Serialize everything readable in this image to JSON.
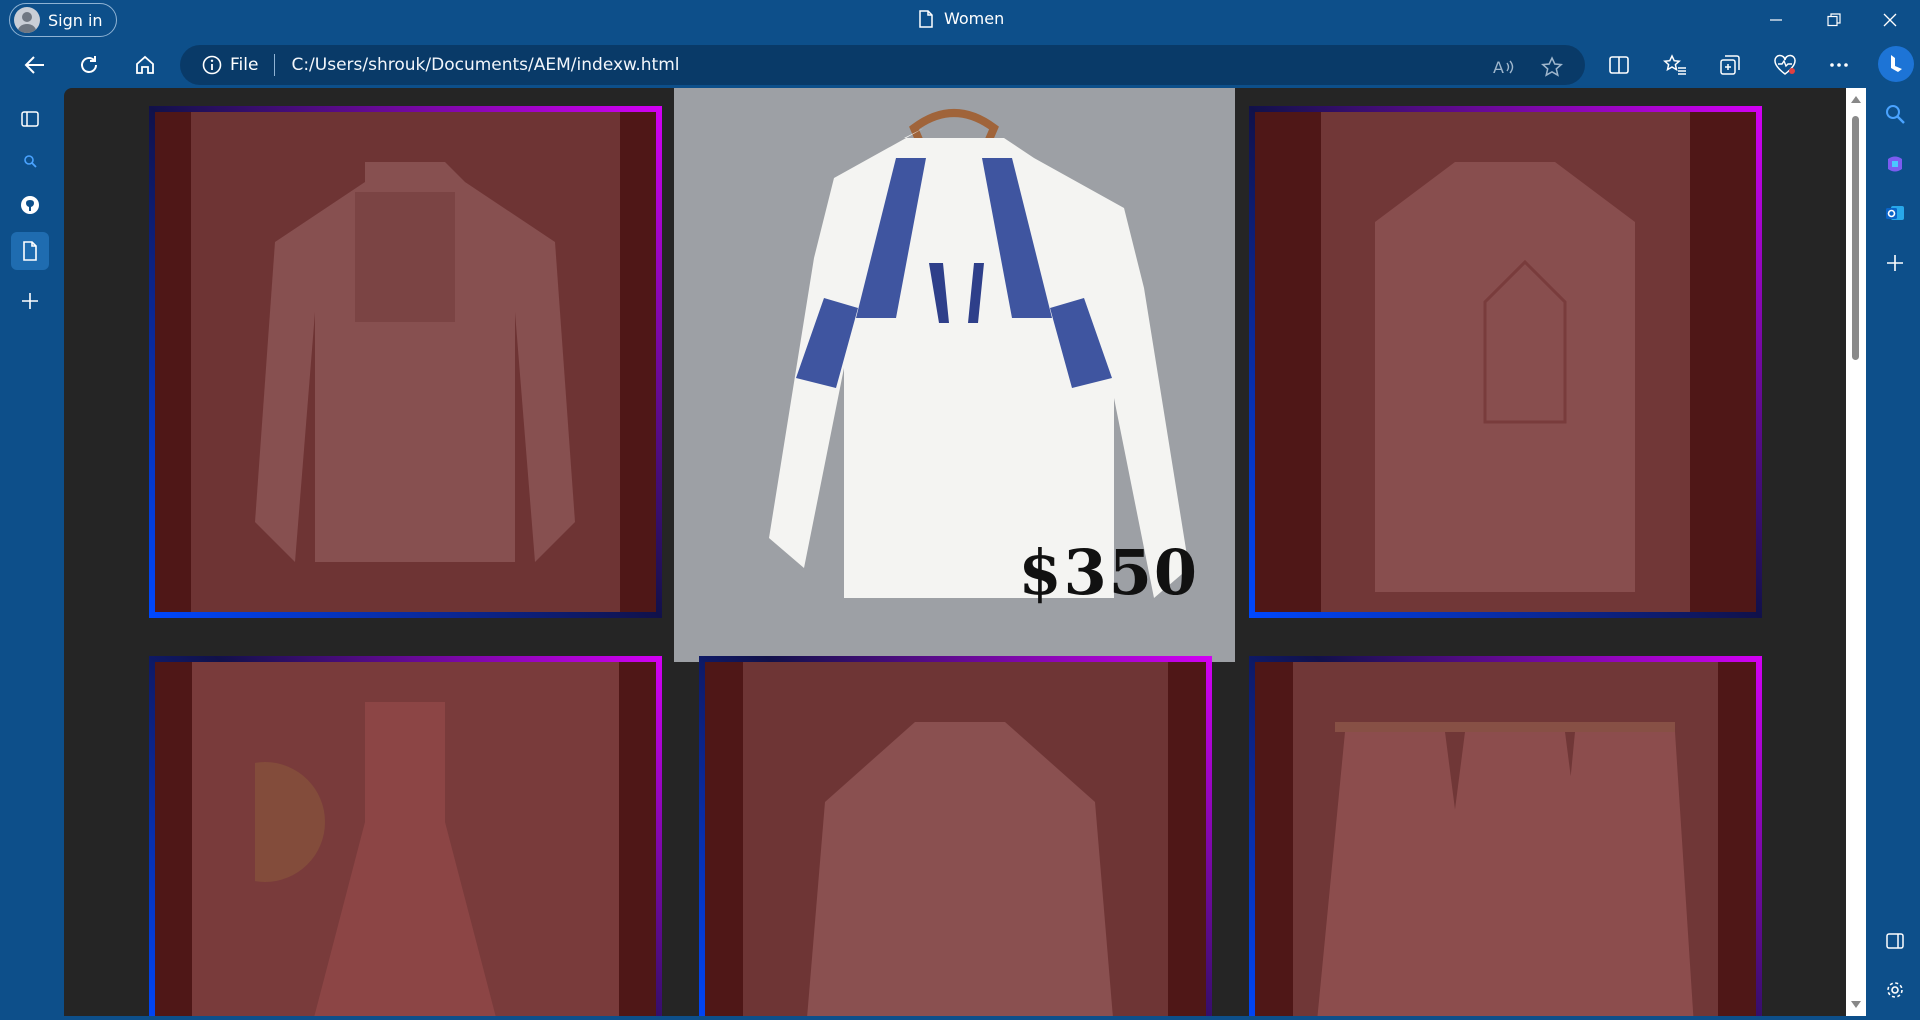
{
  "window": {
    "title": "Women",
    "sign_in_label": "Sign in"
  },
  "address_bar": {
    "scheme_label": "File",
    "url": "C:/Users/shrouk/Documents/AEM/indexw.html"
  },
  "icons": {
    "back": "back-arrow-icon",
    "refresh": "refresh-icon",
    "home": "home-icon",
    "info": "info-icon",
    "read_aloud": "read-aloud-icon",
    "favorite": "star-icon",
    "split_screen": "split-screen-icon",
    "favorites": "favorites-icon",
    "collections": "collections-icon",
    "browser_essentials": "heart-pulse-icon",
    "more": "more-icon",
    "copilot": "copilot-icon"
  },
  "left_sidebar": [
    "tab-actions-icon",
    "search-icon",
    "github-icon",
    "page-icon",
    "add-icon"
  ],
  "right_sidebar": [
    "search-icon",
    "copilot-app-icon",
    "outlook-icon",
    "add-icon",
    "sidebar-toggle-icon",
    "settings-icon"
  ],
  "page": {
    "featured_price": "$350"
  },
  "colors": {
    "browser_chrome": "#0d4f8a",
    "page_bg": "#252525",
    "card_gradient_start": "#0048ff",
    "card_gradient_end": "#d400f5",
    "card_overlay": "#4b1a1a"
  }
}
